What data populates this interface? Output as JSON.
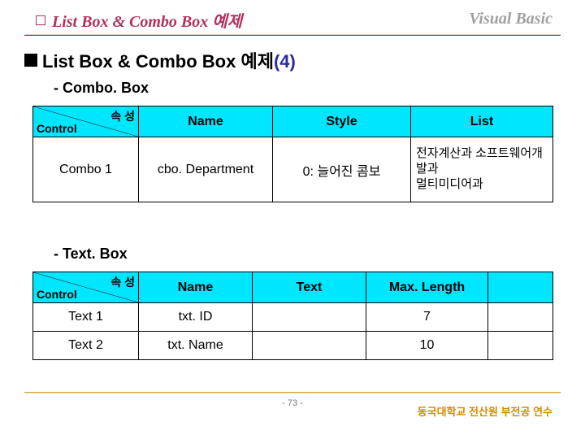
{
  "header": {
    "title": "List Box & Combo Box 예제",
    "right": "Visual Basic"
  },
  "section": {
    "prefix": "List Box & Combo Box 예제",
    "suffix": "(4)"
  },
  "sub": {
    "combo_prefix": "- ",
    "combo": "Combo. Box",
    "text_prefix": "- ",
    "text": "Text. Box"
  },
  "table1": {
    "corner_top": "속 성",
    "corner_bottom": "Control",
    "headers": {
      "name": "Name",
      "style": "Style",
      "list": "List"
    },
    "row": {
      "control": "Combo 1",
      "name": "cbo. Department",
      "style": "0: 늘어진 콤보",
      "list": "전자계산과 소프트웨어개발과\n멀티미디어과"
    }
  },
  "table2": {
    "corner_top": "속 성",
    "corner_bottom": "Control",
    "headers": {
      "name": "Name",
      "text": "Text",
      "maxlength": "Max. Length"
    },
    "rows": [
      {
        "control": "Text 1",
        "name": "txt. ID",
        "text": "",
        "maxlength": "7"
      },
      {
        "control": "Text 2",
        "name": "txt. Name",
        "text": "",
        "maxlength": "10"
      }
    ]
  },
  "footer": {
    "page": "- 73 -",
    "right": "동국대학교 전산원 부전공 연수"
  }
}
